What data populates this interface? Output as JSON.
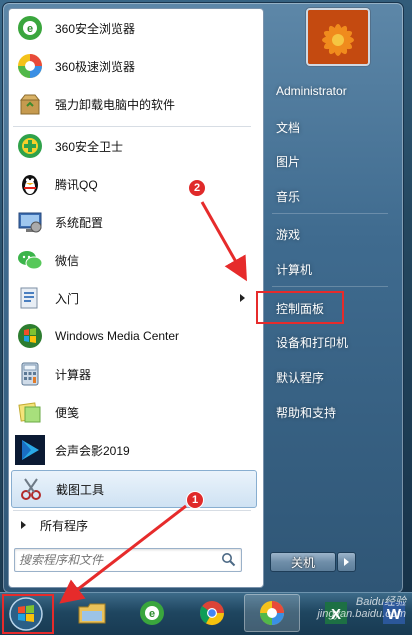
{
  "start_menu": {
    "programs": [
      {
        "label": "360安全浏览器",
        "icon": "360-safe-browser-icon"
      },
      {
        "label": "360极速浏览器",
        "icon": "360-speed-browser-icon"
      },
      {
        "label": "强力卸载电脑中的软件",
        "icon": "uninstall-box-icon"
      },
      {
        "label": "360安全卫士",
        "icon": "360-guard-icon"
      },
      {
        "label": "腾讯QQ",
        "icon": "qq-penguin-icon"
      },
      {
        "label": "系统配置",
        "icon": "system-config-icon"
      },
      {
        "label": "微信",
        "icon": "wechat-icon"
      },
      {
        "label": "入门",
        "icon": "getting-started-icon"
      },
      {
        "label": "Windows Media Center",
        "icon": "media-center-icon"
      },
      {
        "label": "计算器",
        "icon": "calculator-icon"
      },
      {
        "label": "便笺",
        "icon": "sticky-notes-icon"
      },
      {
        "label": "会声会影2019",
        "icon": "video-studio-icon"
      },
      {
        "label": "截图工具",
        "icon": "snipping-tool-icon"
      }
    ],
    "all_programs": "所有程序",
    "search_placeholder": "搜索程序和文件",
    "right": {
      "user": "Administrator",
      "documents": "文档",
      "pictures": "图片",
      "music": "音乐",
      "games": "游戏",
      "computer": "计算机",
      "control_panel": "控制面板",
      "devices_printers": "设备和打印机",
      "default_programs": "默认程序",
      "help_support": "帮助和支持"
    },
    "shutdown": "关机"
  },
  "annotations": {
    "step1": "1",
    "step2": "2"
  },
  "watermark": {
    "line1": "Baidu经验",
    "line2": "jingyan.baidu.com"
  },
  "colors": {
    "annotation_red": "#e62b2b",
    "menu_blue": "#3f6b8f"
  }
}
